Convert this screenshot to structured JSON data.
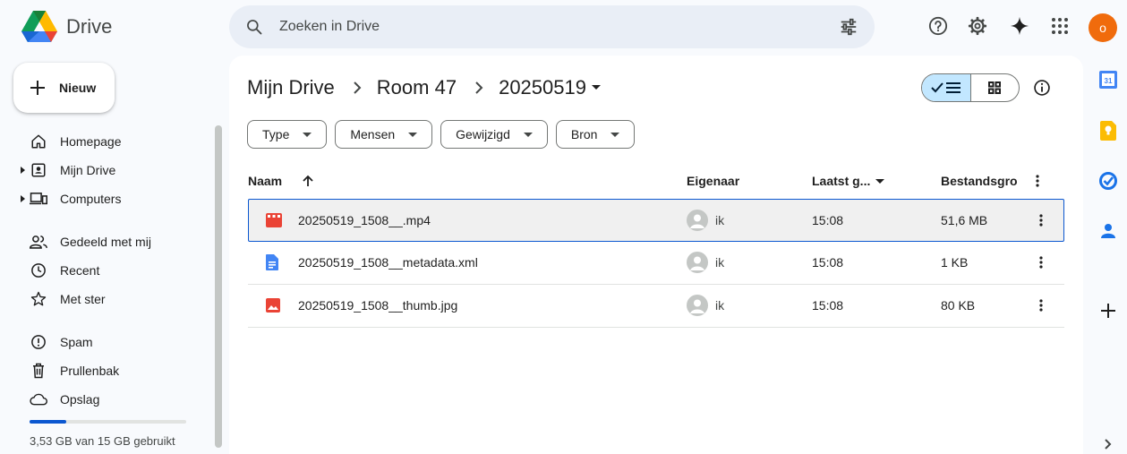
{
  "app": {
    "name": "Drive"
  },
  "search": {
    "placeholder": "Zoeken in Drive"
  },
  "user": {
    "initial": "o",
    "color": "#f06b0c"
  },
  "sidebar": {
    "new_label": "Nieuw",
    "items": [
      {
        "label": "Homepage",
        "icon": "home-icon"
      },
      {
        "label": "Mijn Drive",
        "icon": "my-drive-icon"
      },
      {
        "label": "Computers",
        "icon": "computers-icon"
      },
      {
        "label": "Gedeeld met mij",
        "icon": "shared-icon"
      },
      {
        "label": "Recent",
        "icon": "clock-icon"
      },
      {
        "label": "Met ster",
        "icon": "star-icon"
      },
      {
        "label": "Spam",
        "icon": "spam-icon"
      },
      {
        "label": "Prullenbak",
        "icon": "trash-icon"
      },
      {
        "label": "Opslag",
        "icon": "cloud-icon"
      }
    ],
    "storage": {
      "text": "3,53 GB van 15 GB gebruikt",
      "used_fraction": 0.235
    }
  },
  "breadcrumb": [
    "Mijn Drive",
    "Room 47",
    "20250519"
  ],
  "filters": [
    "Type",
    "Mensen",
    "Gewijzigd",
    "Bron"
  ],
  "table": {
    "headers": {
      "name": "Naam",
      "owner": "Eigenaar",
      "modified": "Laatst g...",
      "size": "Bestandsgro"
    },
    "rows": [
      {
        "name": "20250519_1508__.mp4",
        "owner": "ik",
        "modified": "15:08",
        "size": "51,6 MB",
        "type": "video",
        "selected": true
      },
      {
        "name": "20250519_1508__metadata.xml",
        "owner": "ik",
        "modified": "15:08",
        "size": "1 KB",
        "type": "document",
        "selected": false
      },
      {
        "name": "20250519_1508__thumb.jpg",
        "owner": "ik",
        "modified": "15:08",
        "size": "80 KB",
        "type": "image",
        "selected": false
      }
    ]
  },
  "colors": {
    "accent": "#0b57d0",
    "selected_view": "#c2e7ff",
    "video": "#ea4335",
    "doc": "#4285f4",
    "image": "#ea4335"
  }
}
